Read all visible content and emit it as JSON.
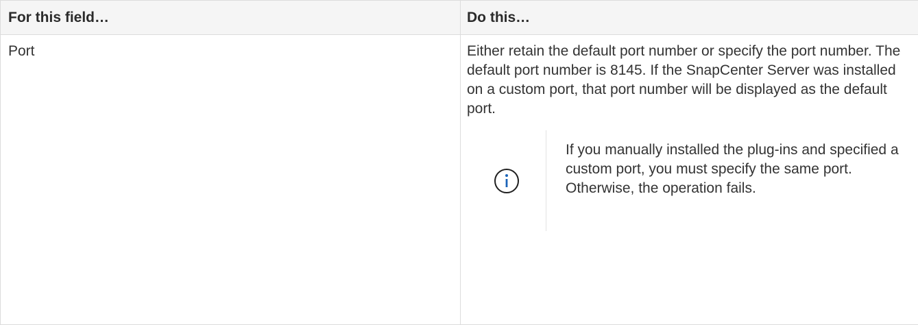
{
  "table": {
    "header": {
      "field": "For this field…",
      "action": "Do this…"
    },
    "rows": [
      {
        "field": "Port",
        "description": "Either retain the default port number or specify the port number. The default port number is 8145. If the SnapCenter Server was installed on a custom port, that port number will be displayed as the default port.",
        "note": {
          "icon": "info-icon",
          "text": "If you manually installed the plug-ins and specified a custom port, you must specify the same port. Otherwise, the operation fails."
        }
      }
    ]
  },
  "colors": {
    "info_icon": "#1a63b8",
    "header_background": "#f5f5f5",
    "border": "#dcdcdc"
  }
}
